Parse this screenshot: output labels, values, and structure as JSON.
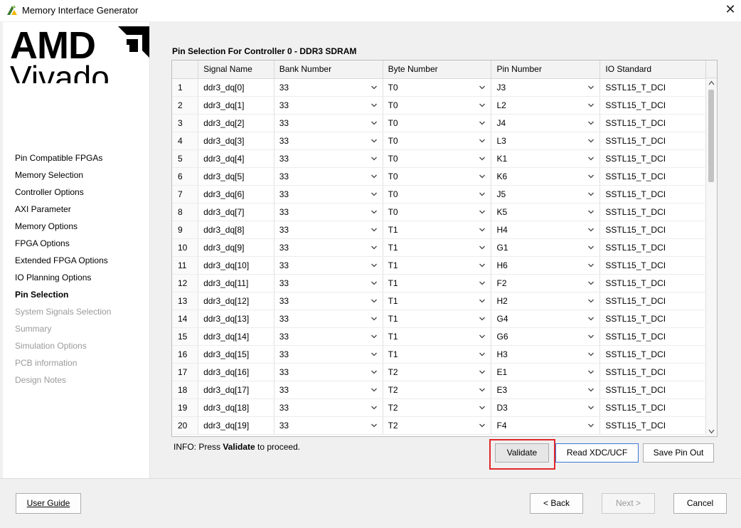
{
  "window": {
    "title": "Memory Interface Generator",
    "close_glyph": "✕"
  },
  "brand": {
    "company": "AMD",
    "product": "Vivado"
  },
  "sidebar": {
    "items": [
      {
        "label": "Pin Compatible FPGAs",
        "state": "normal"
      },
      {
        "label": "Memory Selection",
        "state": "normal"
      },
      {
        "label": "Controller Options",
        "state": "normal"
      },
      {
        "label": "AXI Parameter",
        "state": "normal"
      },
      {
        "label": "Memory Options",
        "state": "normal"
      },
      {
        "label": "FPGA Options",
        "state": "normal"
      },
      {
        "label": "Extended FPGA Options",
        "state": "normal"
      },
      {
        "label": "IO Planning Options",
        "state": "normal"
      },
      {
        "label": "Pin Selection",
        "state": "active"
      },
      {
        "label": "System Signals Selection",
        "state": "disabled"
      },
      {
        "label": "Summary",
        "state": "disabled"
      },
      {
        "label": "Simulation Options",
        "state": "disabled"
      },
      {
        "label": "PCB information",
        "state": "disabled"
      },
      {
        "label": "Design Notes",
        "state": "disabled"
      }
    ]
  },
  "main": {
    "section_title": "Pin Selection For Controller 0 - DDR3 SDRAM",
    "table": {
      "columns": [
        "",
        "Signal Name",
        "Bank Number",
        "Byte Number",
        "Pin Number",
        "IO Standard"
      ],
      "rows": [
        {
          "num": "1",
          "signal": "ddr3_dq[0]",
          "bank": "33",
          "byte": "T0",
          "pin": "J3",
          "io": "SSTL15_T_DCI"
        },
        {
          "num": "2",
          "signal": "ddr3_dq[1]",
          "bank": "33",
          "byte": "T0",
          "pin": "L2",
          "io": "SSTL15_T_DCI"
        },
        {
          "num": "3",
          "signal": "ddr3_dq[2]",
          "bank": "33",
          "byte": "T0",
          "pin": "J4",
          "io": "SSTL15_T_DCI"
        },
        {
          "num": "4",
          "signal": "ddr3_dq[3]",
          "bank": "33",
          "byte": "T0",
          "pin": "L3",
          "io": "SSTL15_T_DCI"
        },
        {
          "num": "5",
          "signal": "ddr3_dq[4]",
          "bank": "33",
          "byte": "T0",
          "pin": "K1",
          "io": "SSTL15_T_DCI"
        },
        {
          "num": "6",
          "signal": "ddr3_dq[5]",
          "bank": "33",
          "byte": "T0",
          "pin": "K6",
          "io": "SSTL15_T_DCI"
        },
        {
          "num": "7",
          "signal": "ddr3_dq[6]",
          "bank": "33",
          "byte": "T0",
          "pin": "J5",
          "io": "SSTL15_T_DCI"
        },
        {
          "num": "8",
          "signal": "ddr3_dq[7]",
          "bank": "33",
          "byte": "T0",
          "pin": "K5",
          "io": "SSTL15_T_DCI"
        },
        {
          "num": "9",
          "signal": "ddr3_dq[8]",
          "bank": "33",
          "byte": "T1",
          "pin": "H4",
          "io": "SSTL15_T_DCI"
        },
        {
          "num": "10",
          "signal": "ddr3_dq[9]",
          "bank": "33",
          "byte": "T1",
          "pin": "G1",
          "io": "SSTL15_T_DCI"
        },
        {
          "num": "11",
          "signal": "ddr3_dq[10]",
          "bank": "33",
          "byte": "T1",
          "pin": "H6",
          "io": "SSTL15_T_DCI"
        },
        {
          "num": "12",
          "signal": "ddr3_dq[11]",
          "bank": "33",
          "byte": "T1",
          "pin": "F2",
          "io": "SSTL15_T_DCI"
        },
        {
          "num": "13",
          "signal": "ddr3_dq[12]",
          "bank": "33",
          "byte": "T1",
          "pin": "H2",
          "io": "SSTL15_T_DCI"
        },
        {
          "num": "14",
          "signal": "ddr3_dq[13]",
          "bank": "33",
          "byte": "T1",
          "pin": "G4",
          "io": "SSTL15_T_DCI"
        },
        {
          "num": "15",
          "signal": "ddr3_dq[14]",
          "bank": "33",
          "byte": "T1",
          "pin": "G6",
          "io": "SSTL15_T_DCI"
        },
        {
          "num": "16",
          "signal": "ddr3_dq[15]",
          "bank": "33",
          "byte": "T1",
          "pin": "H3",
          "io": "SSTL15_T_DCI"
        },
        {
          "num": "17",
          "signal": "ddr3_dq[16]",
          "bank": "33",
          "byte": "T2",
          "pin": "E1",
          "io": "SSTL15_T_DCI"
        },
        {
          "num": "18",
          "signal": "ddr3_dq[17]",
          "bank": "33",
          "byte": "T2",
          "pin": "E3",
          "io": "SSTL15_T_DCI"
        },
        {
          "num": "19",
          "signal": "ddr3_dq[18]",
          "bank": "33",
          "byte": "T2",
          "pin": "D3",
          "io": "SSTL15_T_DCI"
        },
        {
          "num": "20",
          "signal": "ddr3_dq[19]",
          "bank": "33",
          "byte": "T2",
          "pin": "F4",
          "io": "SSTL15_T_DCI"
        }
      ]
    },
    "info_prefix": "INFO: Press ",
    "info_bold": "Validate",
    "info_suffix": " to proceed.",
    "buttons": {
      "validate": "Validate",
      "read_xdc": "Read XDC/UCF",
      "save_pin_out": "Save Pin Out"
    }
  },
  "footer": {
    "user_guide": "User Guide",
    "back": "< Back",
    "next": "Next >",
    "cancel": "Cancel"
  },
  "colors": {
    "highlight": "#e3262a",
    "focus_border": "#3b78d8",
    "disabled_text": "#9a9a9a"
  }
}
